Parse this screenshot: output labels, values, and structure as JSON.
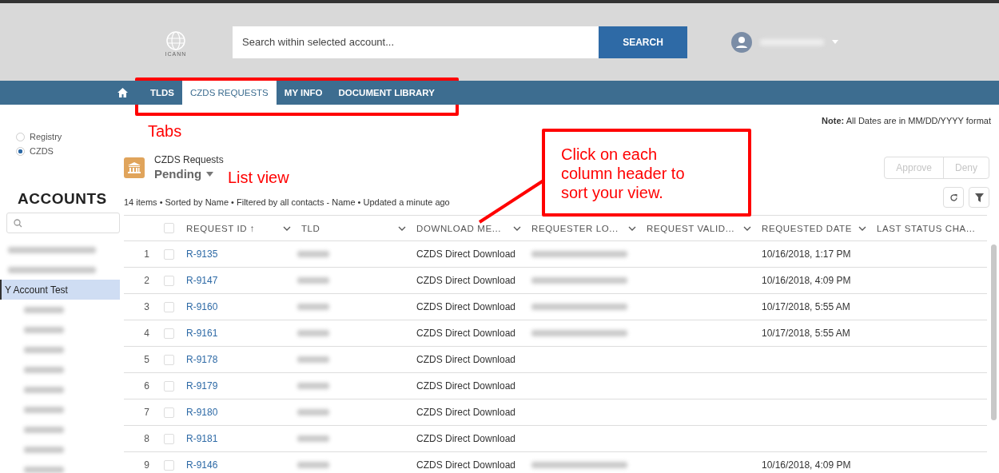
{
  "header": {
    "logo_text": "ICANN",
    "search": {
      "placeholder": "Search within selected account..."
    },
    "search_button": "SEARCH",
    "user_name_redacted": true
  },
  "nav": {
    "tabs": [
      {
        "label": "TLDS",
        "selected": false
      },
      {
        "label": "CZDS REQUESTS",
        "selected": true
      },
      {
        "label": "MY INFO",
        "selected": false
      },
      {
        "label": "DOCUMENT LIBRARY",
        "selected": false
      }
    ]
  },
  "sidebar": {
    "scope_options": [
      {
        "label": "Registry",
        "selected": false
      },
      {
        "label": "CZDS",
        "selected": true
      }
    ],
    "title": "ACCOUNTS",
    "items": [
      {
        "kind": "redacted",
        "selected": false
      },
      {
        "kind": "redacted",
        "selected": false
      },
      {
        "kind": "text",
        "label": "Y Account Test",
        "selected": true,
        "children": [
          {
            "kind": "redacted",
            "selected": false
          },
          {
            "kind": "redacted",
            "selected": false
          },
          {
            "kind": "redacted",
            "selected": false
          },
          {
            "kind": "redacted",
            "selected": false
          },
          {
            "kind": "redacted",
            "selected": false
          },
          {
            "kind": "redacted",
            "selected": false
          },
          {
            "kind": "redacted",
            "selected": false
          },
          {
            "kind": "redacted",
            "selected": false
          },
          {
            "kind": "redacted",
            "selected": false
          }
        ]
      }
    ]
  },
  "note": "**Note:** All Dates are in MM/DD/YYYY format",
  "list_view": {
    "object_label": "CZDS Requests",
    "view_name": "Pending",
    "summary": "14 items • Sorted by Name • Filtered by all contacts - Name • Updated a minute ago",
    "actions": [
      {
        "label": "Approve",
        "disabled": true
      },
      {
        "label": "Deny",
        "disabled": true
      }
    ]
  },
  "table": {
    "select_all_checked": false,
    "columns": [
      {
        "label": "REQUEST ID",
        "sort_indicator": "↑"
      },
      {
        "label": "TLD"
      },
      {
        "label": "DOWNLOAD ME..."
      },
      {
        "label": "REQUESTER LO..."
      },
      {
        "label": "REQUEST VALID..."
      },
      {
        "label": "REQUESTED DATE"
      },
      {
        "label": "LAST STATUS CHA..."
      }
    ],
    "rows": [
      {
        "number": "1",
        "checked": false,
        "request_id": "R-9135",
        "tld_redacted": true,
        "download_method": "CZDS Direct Download",
        "requester_redacted": true,
        "requested_date": "10/16/2018, 1:17 PM"
      },
      {
        "number": "2",
        "checked": false,
        "request_id": "R-9147",
        "tld_redacted": true,
        "download_method": "CZDS Direct Download",
        "requester_redacted": true,
        "requested_date": "10/16/2018, 4:09 PM"
      },
      {
        "number": "3",
        "checked": false,
        "request_id": "R-9160",
        "tld_redacted": true,
        "download_method": "CZDS Direct Download",
        "requester_redacted": true,
        "requested_date": "10/17/2018, 5:55 AM"
      },
      {
        "number": "4",
        "checked": false,
        "request_id": "R-9161",
        "tld_redacted": true,
        "download_method": "CZDS Direct Download",
        "requester_redacted": true,
        "requested_date": "10/17/2018, 5:55 AM"
      },
      {
        "number": "5",
        "checked": false,
        "request_id": "R-9178",
        "tld_redacted": true,
        "download_method": "CZDS Direct Download",
        "requester_redacted": false
      },
      {
        "number": "6",
        "checked": false,
        "request_id": "R-9179",
        "tld_redacted": true,
        "download_method": "CZDS Direct Download",
        "requester_redacted": false
      },
      {
        "number": "7",
        "checked": false,
        "request_id": "R-9180",
        "tld_redacted": true,
        "download_method": "CZDS Direct Download",
        "requester_redacted": false
      },
      {
        "number": "8",
        "checked": false,
        "request_id": "R-9181",
        "tld_redacted": true,
        "download_method": "CZDS Direct Download",
        "requester_redacted": false
      },
      {
        "number": "9",
        "checked": false,
        "request_id": "R-9146",
        "tld_redacted": true,
        "download_method": "CZDS Direct Download",
        "requester_redacted": true,
        "requested_date": "10/16/2018, 4:09 PM"
      }
    ]
  },
  "annotations": [
    {
      "kind": "frame"
    },
    {
      "kind": "label",
      "text": "Tabs"
    },
    {
      "kind": "label",
      "text": "List view"
    },
    {
      "kind": "callout",
      "text": "Click on each column header to sort your view."
    }
  ]
}
